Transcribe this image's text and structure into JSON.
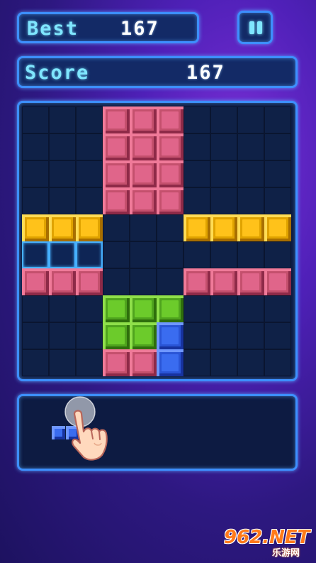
{
  "hud": {
    "best_label": "Best",
    "best_value": "167",
    "score_label": "Score",
    "score_value": "167",
    "pause_icon": "pause-icon"
  },
  "board": {
    "rows": 10,
    "cols": 10,
    "cells": [
      [
        null,
        null,
        null,
        "pink",
        "pink",
        "pink",
        null,
        null,
        null,
        null
      ],
      [
        null,
        null,
        null,
        "pink",
        "pink",
        "pink",
        null,
        null,
        null,
        null
      ],
      [
        null,
        null,
        null,
        "pink",
        "pink",
        "pink",
        null,
        null,
        null,
        null
      ],
      [
        null,
        null,
        null,
        "pink",
        "pink",
        "pink",
        null,
        null,
        null,
        null
      ],
      [
        "yellow",
        "yellow",
        "yellow",
        null,
        null,
        null,
        "yellow",
        "yellow",
        "yellow",
        "yellow"
      ],
      [
        "ghost",
        "ghost",
        "ghost",
        null,
        null,
        null,
        null,
        null,
        null,
        null
      ],
      [
        "pink",
        "pink",
        "pink",
        null,
        null,
        null,
        "pink",
        "pink",
        "pink",
        "pink"
      ],
      [
        null,
        null,
        null,
        "green",
        "green",
        "green",
        null,
        null,
        null,
        null
      ],
      [
        null,
        null,
        null,
        "green",
        "green",
        "blue",
        null,
        null,
        null,
        null
      ],
      [
        null,
        null,
        null,
        "pink",
        "pink",
        "blue",
        null,
        null,
        null,
        null
      ]
    ]
  },
  "tray": {
    "piece_color": "blue",
    "piece_cells": 2,
    "pointer": "pointing-hand-icon"
  },
  "colors": {
    "pink": "#e0658a",
    "yellow": "#ffc21a",
    "green": "#6ccb2b",
    "blue": "#3a6cf0",
    "hud_text": "#7fe6ff",
    "panel_border": "#3d8fff"
  },
  "watermark": {
    "main": "962.NET",
    "sub": "乐游网"
  }
}
